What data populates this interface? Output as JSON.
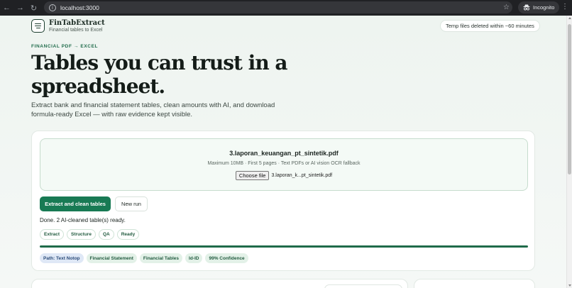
{
  "browser": {
    "url": "localhost:3000",
    "incognito_label": "Incognito",
    "icons": [
      "back-arrow-icon",
      "forward-arrow-icon",
      "reload-icon",
      "site-info-icon",
      "star-icon",
      "incognito-icon",
      "kebab-menu-icon"
    ]
  },
  "brand": {
    "name": "FinTabExtract",
    "tagline": "Financial tables to Excel"
  },
  "temp_note": "Temp files deleted within ~60 minutes",
  "hero": {
    "eyebrow": "FINANCIAL PDF → EXCEL",
    "title": "Tables you can trust in a spreadsheet.",
    "lede": "Extract bank and financial statement tables, clean amounts with AI, and download formula-ready Excel — with raw evidence kept visible."
  },
  "upload": {
    "file_title": "3.laporan_keuangan_pt_sintetik.pdf",
    "limits": "Maximum 10MB · First 5 pages · Text PDFs or AI vision OCR fallback",
    "choose_label": "Choose file",
    "chosen_file": "3.laporan_k...pt_sintetik.pdf"
  },
  "actions": {
    "extract_label": "Extract and clean tables",
    "new_run_label": "New run"
  },
  "status": "Done. 2 AI-cleaned table(s) ready.",
  "stages": [
    "Extract",
    "Structure",
    "QA",
    "Ready"
  ],
  "progress": 1.0,
  "tags": {
    "path": "Path: Text Notop",
    "items": [
      "Financial Statement",
      "Financial Tables",
      "Id-ID",
      "99% Confidence"
    ]
  },
  "colors": {
    "accent": "#187a54",
    "accent_dark": "#1f6b4a",
    "chip_bg": "#e3f1e8",
    "path_chip_bg": "#dfe8f6"
  }
}
